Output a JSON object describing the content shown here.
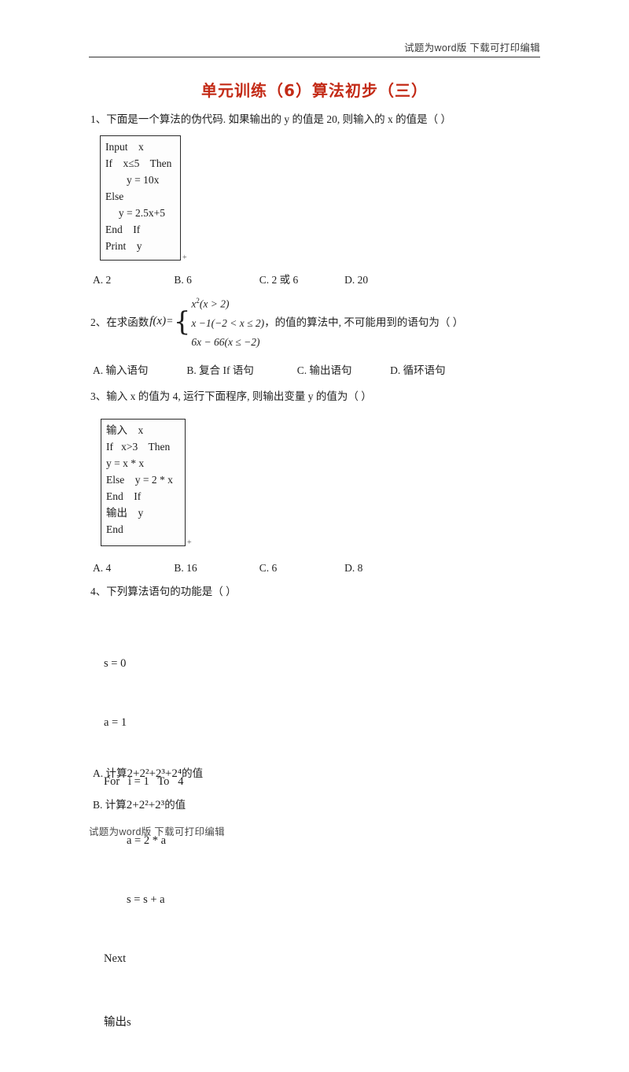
{
  "header": {
    "text": "试题为word版  下载可打印编辑"
  },
  "title": {
    "text": "单元训练（6）算法初步（三）",
    "color": "#c32a16"
  },
  "questions": {
    "q1": {
      "stem": "1、下面是一个算法的伪代码. 如果输出的 y 的值是 20, 则输入的 x 的值是（    ）",
      "code": {
        "line1": "Input    x",
        "line2": "If    x≤5    Then",
        "line3": "        y = 10x",
        "line4": "Else",
        "line5": "     y = 2.5x+5",
        "line6": "End    If",
        "line7": "Print    y",
        "anchor": "+"
      },
      "options": {
        "a": "A. 2",
        "b": "B. 6",
        "c": "C. 2 或 6",
        "d": "D. 20"
      }
    },
    "q2": {
      "lead": "2、在求函数",
      "fx": "f(x)",
      "equals": "=",
      "case1": "x",
      "case1_exp": "2",
      "case1_cond": "(x > 2)",
      "case2": "x −1(−2 < x ≤ 2)",
      "case3": "6x − 66(x ≤ −2)",
      "tail": "，的值的算法中, 不可能用到的语句为（    ）",
      "options": {
        "a": "A. 输入语句",
        "b": "B. 复合 If 语句",
        "c": "C. 输出语句",
        "d": "D. 循环语句"
      }
    },
    "q3": {
      "stem": "3、输入 x 的值为 4, 运行下面程序, 则输出变量 y 的值为（    ）",
      "code": {
        "line1": "输入    x",
        "line2": "If   x>3    Then",
        "line3": "y = x * x",
        "line4": "Else    y = 2 * x",
        "line5": "End    If",
        "line6": "输出    y",
        "line7": "End",
        "anchor": "+"
      },
      "options": {
        "a": "A. 4",
        "b": "B. 16",
        "c": "C. 6",
        "d": "D. 8"
      }
    },
    "q4": {
      "stem": "4、下列算法语句的功能是（    ）",
      "code": {
        "line1": "s = 0",
        "line2": "a = 1",
        "line3": "For   i = 1   To   4",
        "line4": "        a = 2 * a",
        "line5": "        s = s + a",
        "line6": "Next",
        "line7": "输出s"
      },
      "options": {
        "a_prefix": "A. 计算",
        "a_expr": "2+2²+2³+2⁴",
        "a_suffix": "的值",
        "b_prefix": "B. 计算",
        "b_expr": "2+2²+2³",
        "b_suffix": "的值"
      }
    }
  },
  "footer": {
    "text": "试题为word版  下载可打印编辑"
  }
}
